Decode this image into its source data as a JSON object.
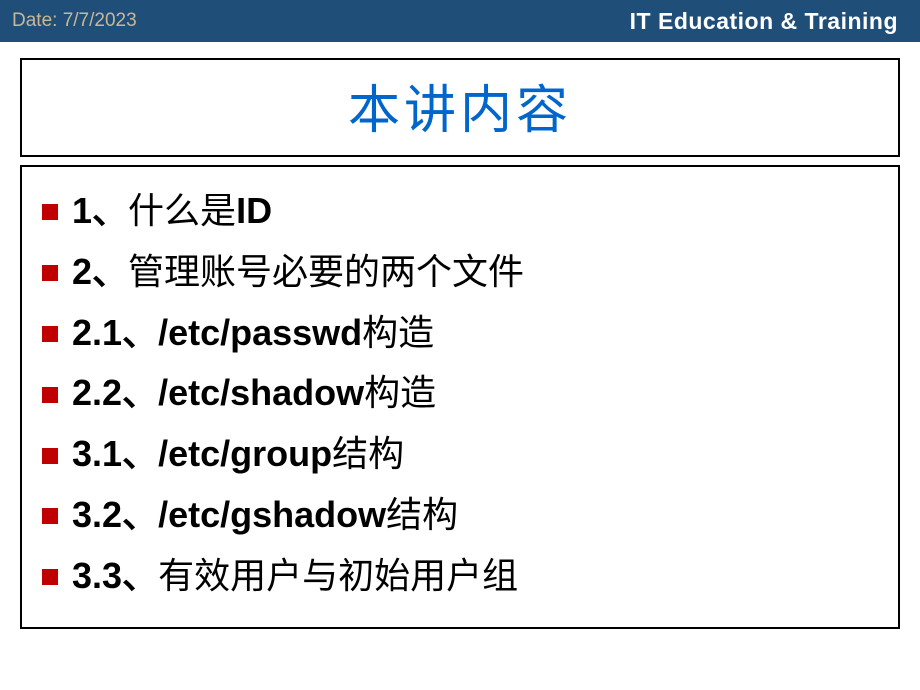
{
  "header": {
    "date_label": "Date: 7/7/2023",
    "brand": "IT Education & Training"
  },
  "title": "本讲内容",
  "items": [
    {
      "num": "1",
      "sep": "、",
      "latin": "",
      "cn_prefix": "什么是",
      "latin2": "ID",
      "cn_suffix": ""
    },
    {
      "num": "2",
      "sep": "、",
      "latin": "",
      "cn_prefix": "管理账号必要的两个文件",
      "latin2": "",
      "cn_suffix": ""
    },
    {
      "num": "2.1",
      "sep": "、",
      "latin": "/etc/passwd",
      "cn_prefix": "",
      "latin2": "",
      "cn_suffix": "构造"
    },
    {
      "num": "2.2",
      "sep": "、",
      "latin": "/etc/shadow",
      "cn_prefix": "",
      "latin2": "",
      "cn_suffix": "构造"
    },
    {
      "num": "3.1",
      "sep": "、",
      "latin": "/etc/group",
      "cn_prefix": "",
      "latin2": "",
      "cn_suffix": "结构"
    },
    {
      "num": "3.2",
      "sep": "、",
      "latin": "/etc/gshadow",
      "cn_prefix": "",
      "latin2": "",
      "cn_suffix": "结构"
    },
    {
      "num": "3.3",
      "sep": "、",
      "latin": "",
      "cn_prefix": "有效用户与初始用户组",
      "latin2": "",
      "cn_suffix": ""
    }
  ]
}
